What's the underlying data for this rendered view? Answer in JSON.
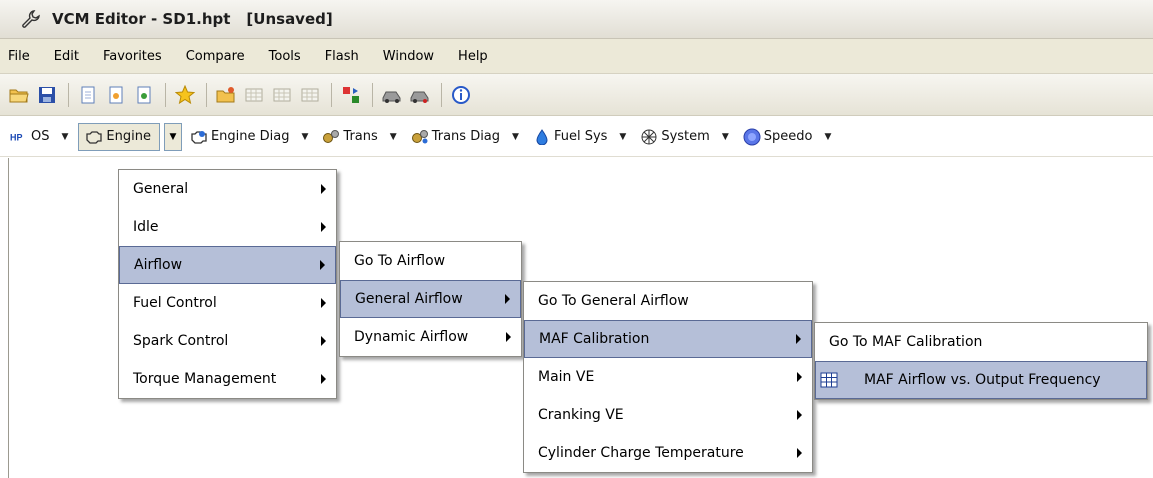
{
  "window": {
    "title": "VCM Editor - SD1.hpt",
    "status": "[Unsaved]",
    "icon": "wrench-icon"
  },
  "menubar": [
    "File",
    "Edit",
    "Favorites",
    "Compare",
    "Tools",
    "Flash",
    "Window",
    "Help"
  ],
  "toolbar": {
    "buttons": [
      "open-folder-icon",
      "save-icon",
      "separator",
      "page-icon",
      "document-icon",
      "document-go-icon",
      "separator",
      "favorite-star-icon",
      "separator",
      "folder-star-icon",
      "grid-icon",
      "grid-add-icon",
      "grid-compare-icon",
      "separator",
      "compare-icon",
      "separator",
      "car-icon",
      "car-go-icon",
      "separator",
      "info-icon"
    ]
  },
  "tabs": [
    {
      "label": "OS",
      "icon": "hp-logo-icon"
    },
    {
      "label": "Engine",
      "icon": "engine-icon"
    },
    {
      "label": "Engine Diag",
      "icon": "engine-diag-icon"
    },
    {
      "label": "Trans",
      "icon": "gears-icon"
    },
    {
      "label": "Trans Diag",
      "icon": "gears-diag-icon"
    },
    {
      "label": "Fuel Sys",
      "icon": "fuel-drop-icon"
    },
    {
      "label": "System",
      "icon": "fan-icon"
    },
    {
      "label": "Speedo",
      "icon": "speedo-icon"
    }
  ],
  "menus": {
    "engine": [
      "General",
      "Idle",
      "Airflow",
      "Fuel Control",
      "Spark Control",
      "Torque Management"
    ],
    "airflow": [
      "Go To Airflow",
      "General Airflow",
      "Dynamic Airflow"
    ],
    "general_airflow": [
      "Go To General Airflow",
      "MAF Calibration",
      "Main VE",
      "Cranking VE",
      "Cylinder Charge Temperature"
    ],
    "maf_calibration": [
      "Go To MAF Calibration",
      "MAF Airflow vs. Output Frequency"
    ]
  },
  "colors": {
    "highlight": "#b5bfd8",
    "highlight_border": "#5a6a95",
    "menubar_bg": "#ece9d8"
  }
}
